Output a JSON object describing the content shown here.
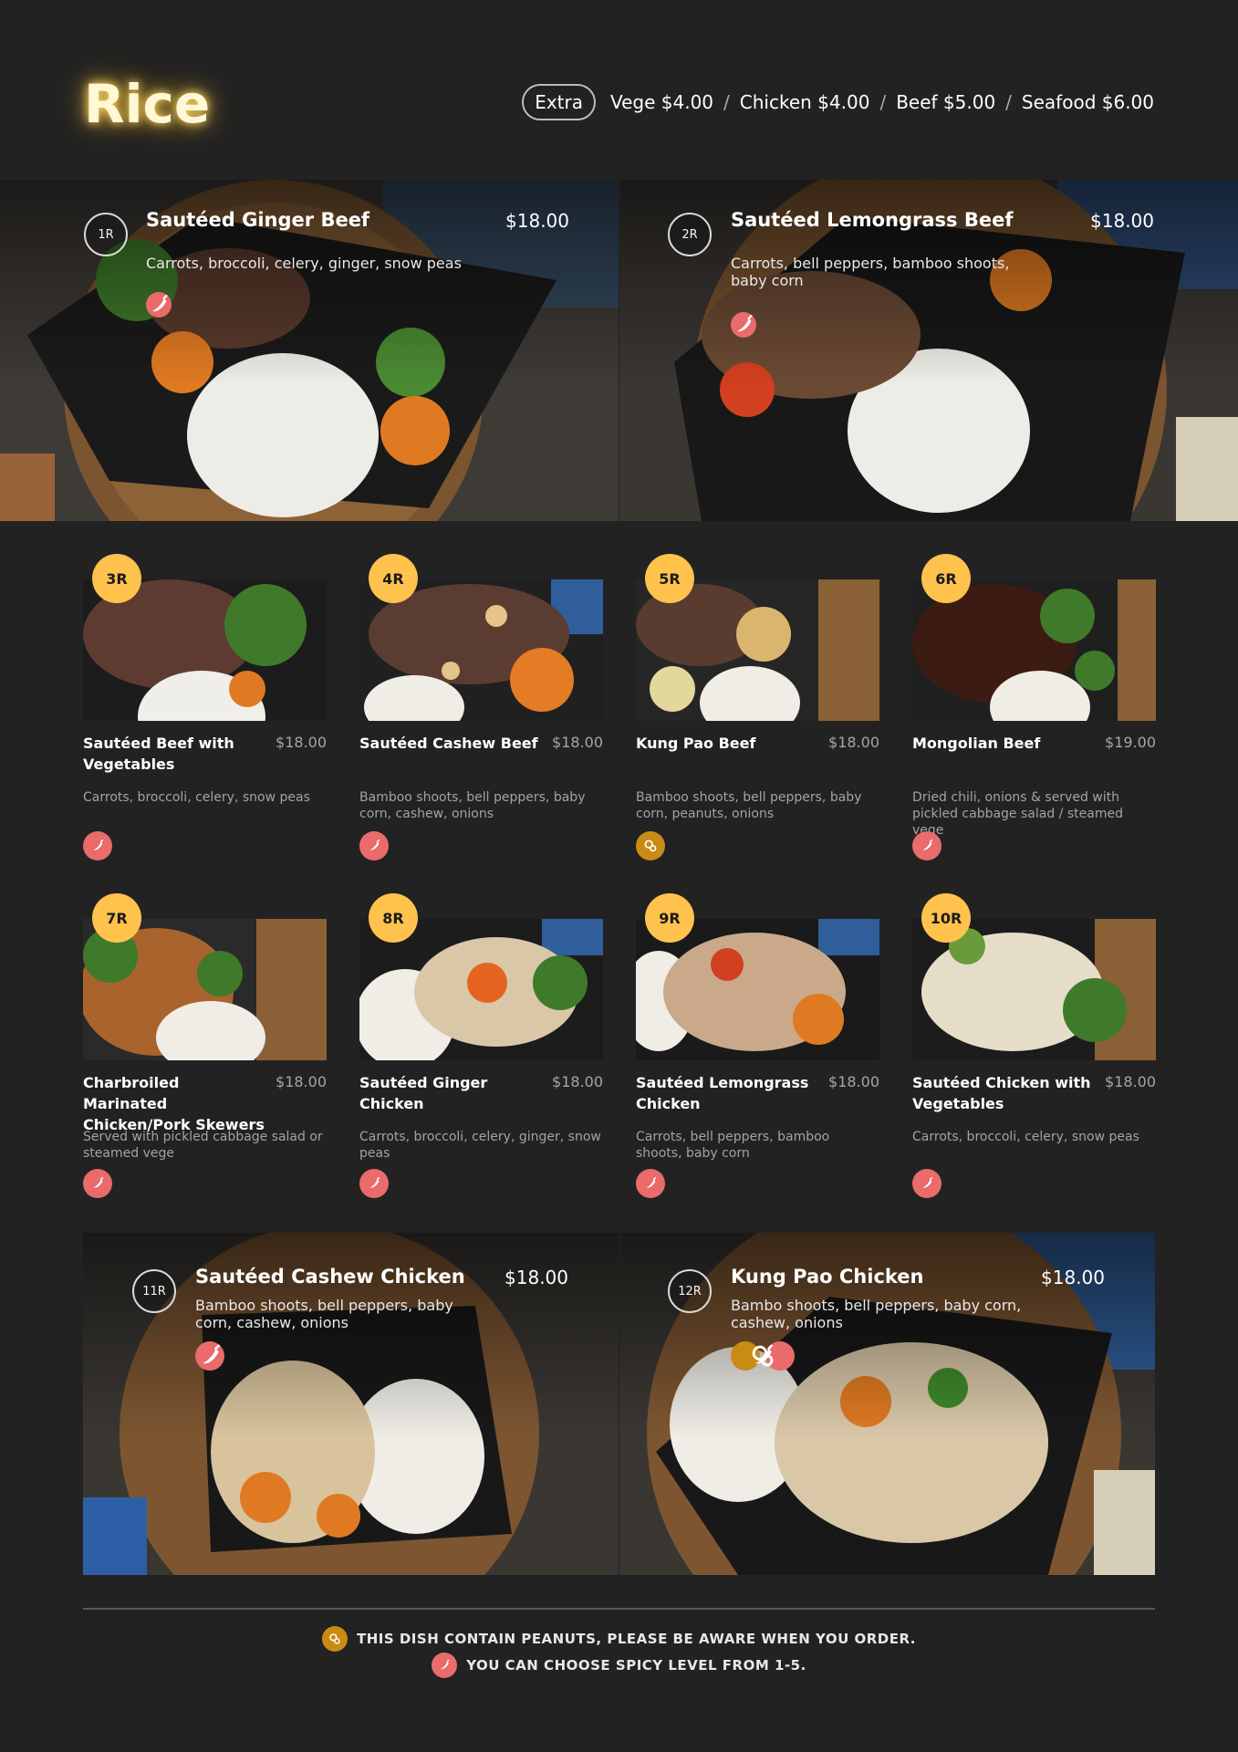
{
  "page": {
    "title": "Rice"
  },
  "extras": {
    "label": "Extra",
    "items": [
      "Vege $4.00",
      "Chicken $4.00",
      "Beef $5.00",
      "Seafood $6.00"
    ],
    "separator": "/"
  },
  "featured_top": [
    {
      "code": "1R",
      "name": "Sautéed Ginger Beef",
      "price": "$18.00",
      "description": "Carrots, broccoli, celery, ginger, snow peas",
      "icons": [
        "spicy-icon"
      ]
    },
    {
      "code": "2R",
      "name": "Sautéed Lemongrass Beef",
      "price": "$18.00",
      "description": "Carrots, bell peppers, bamboo shoots, baby corn",
      "icons": [
        "spicy-icon"
      ]
    }
  ],
  "cards": [
    {
      "code": "3R",
      "name": "Sautéed Beef with Vegetables",
      "price": "$18.00",
      "description": "Carrots, broccoli, celery, snow peas",
      "icons": [
        "spicy-icon"
      ]
    },
    {
      "code": "4R",
      "name": "Sautéed Cashew Beef",
      "price": "$18.00",
      "description": "Bamboo shoots, bell peppers, baby corn, cashew, onions",
      "icons": [
        "spicy-icon"
      ]
    },
    {
      "code": "5R",
      "name": "Kung Pao Beef",
      "price": "$18.00",
      "description": "Bamboo shoots, bell peppers, baby corn, peanuts, onions",
      "icons": [
        "peanut-icon"
      ]
    },
    {
      "code": "6R",
      "name": "Mongolian Beef",
      "price": "$19.00",
      "description": "Dried chili, onions & served with pickled cabbage salad / steamed vege",
      "icons": [
        "spicy-icon"
      ]
    },
    {
      "code": "7R",
      "name": "Charbroiled Marinated Chicken/Pork Skewers",
      "price": "$18.00",
      "description": "Served with pickled cabbage salad or steamed vege",
      "icons": [
        "spicy-icon"
      ]
    },
    {
      "code": "8R",
      "name": "Sautéed Ginger Chicken",
      "price": "$18.00",
      "description": "Carrots, broccoli, celery, ginger, snow peas",
      "icons": [
        "spicy-icon"
      ]
    },
    {
      "code": "9R",
      "name": "Sautéed Lemongrass Chicken",
      "price": "$18.00",
      "description": "Carrots, bell peppers, bamboo shoots, baby corn",
      "icons": [
        "spicy-icon"
      ]
    },
    {
      "code": "10R",
      "name": "Sautéed Chicken with Vegetables",
      "price": "$18.00",
      "description": "Carrots, broccoli, celery, snow peas",
      "icons": [
        "spicy-icon"
      ]
    }
  ],
  "featured_bottom": [
    {
      "code": "11R",
      "name": "Sautéed Cashew Chicken",
      "price": "$18.00",
      "description": "Bamboo shoots, bell peppers, baby corn, cashew, onions",
      "icons": [
        "spicy-icon"
      ]
    },
    {
      "code": "12R",
      "name": "Kung Pao Chicken",
      "price": "$18.00",
      "description": "Bambo shoots, bell peppers, baby corn, cashew, onions",
      "icons": [
        "peanut-icon",
        "spicy-icon"
      ]
    }
  ],
  "notes": [
    {
      "icon": "peanut-icon",
      "text": "THIS DISH CONTAIN PEANUTS, PLEASE BE AWARE WHEN YOU ORDER."
    },
    {
      "icon": "spicy-icon",
      "text": "YOU CAN CHOOSE SPICY LEVEL FROM 1-5."
    }
  ],
  "colors": {
    "background": "#222222",
    "badge": "#ffc24d",
    "spicy": "#e96b6b",
    "peanut": "#c98a16",
    "title_glow": "#ffd866"
  }
}
